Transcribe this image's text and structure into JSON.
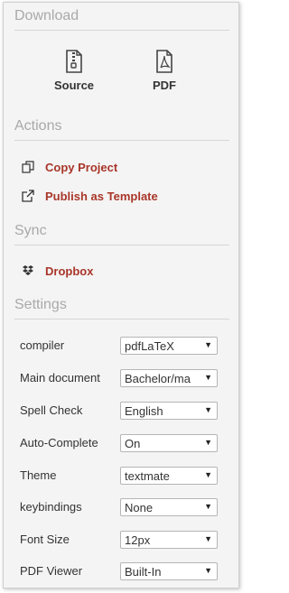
{
  "download": {
    "title": "Download",
    "items": [
      {
        "label": "Source",
        "icon": "file-zip-icon"
      },
      {
        "label": "PDF",
        "icon": "file-pdf-icon"
      }
    ]
  },
  "actions": {
    "title": "Actions",
    "items": [
      {
        "label": "Copy Project",
        "icon": "copy-icon"
      },
      {
        "label": "Publish as Template",
        "icon": "external-link-icon"
      }
    ]
  },
  "sync": {
    "title": "Sync",
    "items": [
      {
        "label": "Dropbox",
        "icon": "dropbox-icon"
      }
    ]
  },
  "settings": {
    "title": "Settings",
    "rows": [
      {
        "label": "compiler",
        "value": "pdfLaTeX"
      },
      {
        "label": "Main document",
        "value": "Bachelor/ma"
      },
      {
        "label": "Spell Check",
        "value": "English"
      },
      {
        "label": "Auto-Complete",
        "value": "On"
      },
      {
        "label": "Theme",
        "value": "textmate"
      },
      {
        "label": "keybindings",
        "value": "None"
      },
      {
        "label": "Font Size",
        "value": "12px"
      },
      {
        "label": "PDF Viewer",
        "value": "Built-In"
      }
    ]
  },
  "colors": {
    "accent": "#a93529",
    "section_title": "#a9a9a9",
    "panel_bg": "#f4f4f4"
  }
}
